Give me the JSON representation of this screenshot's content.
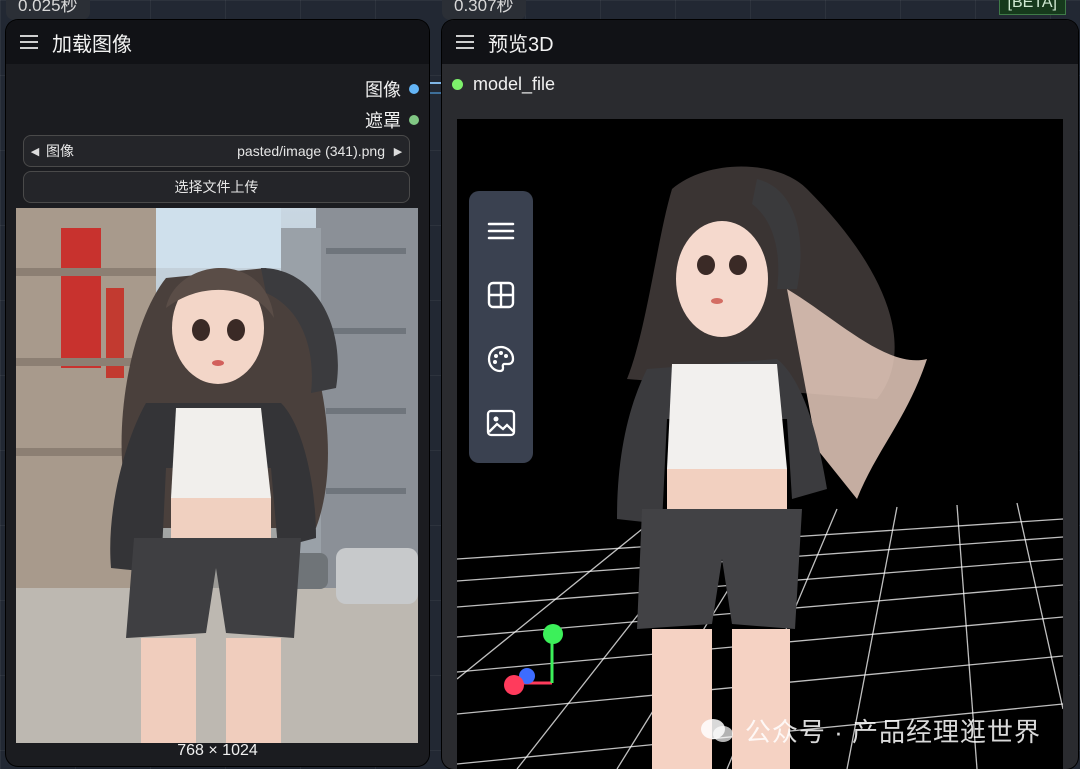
{
  "timings": {
    "left": "0.025秒",
    "right": "0.307秒"
  },
  "beta_badge": "[BETA]",
  "load_image_node": {
    "title": "加载图像",
    "outputs": [
      {
        "label": "图像",
        "color": "#64b5f6"
      },
      {
        "label": "遮罩",
        "color": "#81c784"
      }
    ],
    "image_combo": {
      "label": "图像",
      "value": "pasted/image (341).png"
    },
    "upload_button": "选择文件上传",
    "image_size": "768 × 1024"
  },
  "preview3d_node": {
    "title": "预览3D",
    "input": {
      "label": "model_file",
      "color": "#7df06b"
    },
    "toolbar": [
      "menu-icon",
      "grid-icon",
      "palette-icon",
      "image-icon"
    ]
  },
  "watermark": "公众号 · 产品经理逛世界"
}
